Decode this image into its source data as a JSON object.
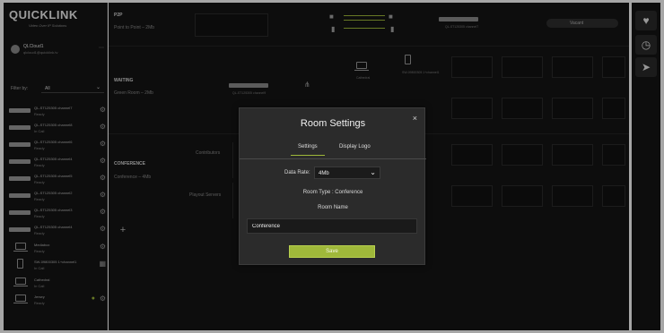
{
  "brand": {
    "logo_text": "QUICKLINK",
    "tagline": "Video Over IP Solutions"
  },
  "user": {
    "name": "QLCloud1",
    "email": "qlcloud1@quicklink.tv"
  },
  "filter": {
    "label": "Filter by:",
    "value": "All"
  },
  "devices": [
    {
      "name": "QL-ST125305 channel7",
      "status": "Ready",
      "icon": "rack-unit-icon"
    },
    {
      "name": "QL-ST125305 channel8",
      "status": "In Call",
      "icon": "rack-unit-icon"
    },
    {
      "name": "QL-ST125305 channel6",
      "status": "Ready",
      "icon": "rack-unit-icon"
    },
    {
      "name": "QL-ST125305 channel4",
      "status": "Ready",
      "icon": "rack-unit-icon"
    },
    {
      "name": "QL-ST125305 channel5",
      "status": "Ready",
      "icon": "rack-unit-icon"
    },
    {
      "name": "QL-ST125305 channel2",
      "status": "Ready",
      "icon": "rack-unit-icon"
    },
    {
      "name": "QL-ST125305 channel3",
      "status": "Ready",
      "icon": "rack-unit-icon"
    },
    {
      "name": "QL-ST125305 channel4",
      "status": "Ready",
      "icon": "rack-unit-icon"
    },
    {
      "name": "Mediabox",
      "status": "Ready",
      "icon": "laptop-icon"
    },
    {
      "name": "SW-09800305 1+channel1",
      "status": "In Call",
      "icon": "phone-icon"
    },
    {
      "name": "Cathedral",
      "status": "In Call",
      "icon": "laptop-icon"
    },
    {
      "name": "Jersey",
      "status": "Ready",
      "icon": "laptop-icon"
    }
  ],
  "rooms": {
    "p2p": {
      "type": "P2P",
      "subtitle": "Point to Point – 2Mb"
    },
    "waiting": {
      "type": "WAITING",
      "subtitle": "Green Room – 2Mb"
    },
    "conference": {
      "type": "CONFERENCE",
      "subtitle": "Conference – 4Mb",
      "contributors_label": "Contributors",
      "playout_label": "Playout Servers"
    },
    "p2p_channel_label": "QL-ST125305 channel7",
    "waiting_channel_label": "QL-ST125305 channel9",
    "waiting_laptop_label": "Cathedral",
    "waiting_phone_label": "SW-09800305 1+channel1",
    "vacant_label": "Vacant"
  },
  "modal": {
    "title": "Room Settings",
    "close_label": "×",
    "tabs": [
      {
        "label": "Settings"
      },
      {
        "label": "Display Logo"
      }
    ],
    "data_rate_label": "Data Rate:",
    "data_rate_value": "4Mb",
    "room_type_text": "Room Type : Conference",
    "room_name_label": "Room Name",
    "room_name_value": "Conference",
    "save_label": "Save"
  },
  "colors": {
    "accent": "#9fb83a",
    "panel": "#151515",
    "modal": "#2b2b2b"
  }
}
